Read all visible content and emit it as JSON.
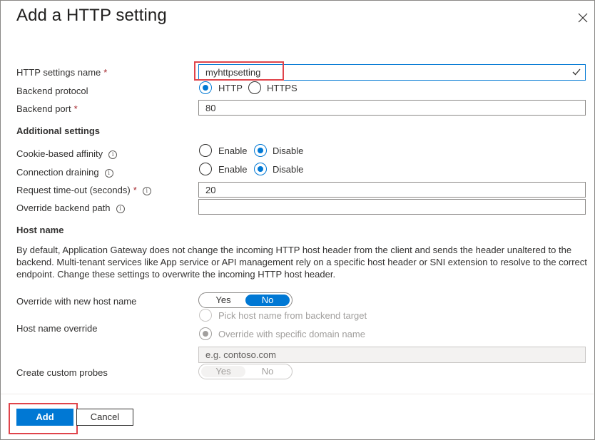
{
  "dialog": {
    "title": "Add a HTTP setting",
    "close_icon": "close-icon"
  },
  "fields": {
    "http_settings_name": {
      "label": "HTTP settings name",
      "required": "*",
      "value": "myhttpsetting"
    },
    "backend_protocol": {
      "label": "Backend protocol",
      "options": [
        "HTTP",
        "HTTPS"
      ],
      "selected": "HTTP"
    },
    "backend_port": {
      "label": "Backend port",
      "required": "*",
      "value": "80"
    }
  },
  "additional": {
    "heading": "Additional settings",
    "cookie_affinity": {
      "label": "Cookie-based affinity",
      "options": [
        "Enable",
        "Disable"
      ],
      "selected": "Disable"
    },
    "connection_draining": {
      "label": "Connection draining",
      "options": [
        "Enable",
        "Disable"
      ],
      "selected": "Disable"
    },
    "request_timeout": {
      "label": "Request time-out (seconds)",
      "required": "*",
      "value": "20"
    },
    "override_path": {
      "label": "Override backend path",
      "value": ""
    }
  },
  "host": {
    "heading": "Host name",
    "description": "By default, Application Gateway does not change the incoming HTTP host header from the client and sends the header unaltered to the backend. Multi-tenant services like App service or API management rely on a specific host header or SNI extension to resolve to the correct endpoint. Change these settings to overwrite the incoming HTTP host header.",
    "override_new": {
      "label": "Override with new host name",
      "options": [
        "Yes",
        "No"
      ],
      "selected": "No"
    },
    "host_override": {
      "label": "Host name override",
      "options": [
        "Pick host name from backend target",
        "Override with specific domain name"
      ],
      "selected": "Override with specific domain name"
    },
    "domain_placeholder": "e.g. contoso.com",
    "custom_probes": {
      "label": "Create custom probes",
      "options": [
        "Yes",
        "No"
      ],
      "selected": "Yes"
    }
  },
  "footer": {
    "add": "Add",
    "cancel": "Cancel"
  },
  "colors": {
    "accent": "#0078d4",
    "highlight": "#e0444b",
    "required": "#a4262c"
  }
}
